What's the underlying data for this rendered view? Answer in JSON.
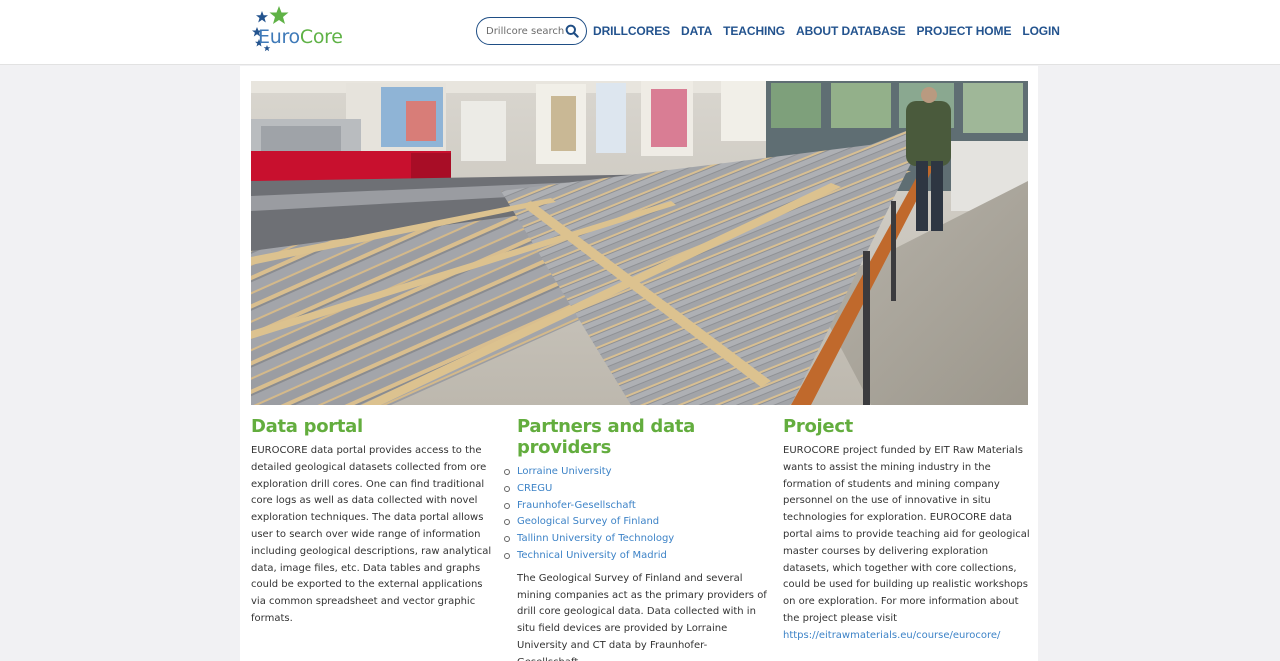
{
  "header": {
    "logo_euro": "Euro",
    "logo_core": "Core",
    "search_placeholder": "Drillcore search",
    "nav": [
      "DRILLCORES",
      "DATA",
      "TEACHING",
      "ABOUT DATABASE",
      "PROJECT HOME",
      "LOGIN"
    ]
  },
  "columns": {
    "data_portal": {
      "title": "Data portal",
      "text": "EUROCORE data portal provides access to the detailed geological datasets collected from ore exploration drill cores. One can find traditional core logs as well as data collected with novel exploration techniques. The data portal allows user to search over wide range of information including geological descriptions, raw analytical data, image files, etc. Data tables and graphs could be exported to the external applications via common spreadsheet and vector graphic formats."
    },
    "partners": {
      "title": "Partners and data providers",
      "items": [
        "Lorraine University",
        "CREGU",
        "Fraunhofer-Gesellschaft",
        "Geological Survey of Finland",
        "Tallinn University of Technology",
        "Technical University of Madrid"
      ],
      "text": "The Geological Survey of Finland and several mining companies act as the primary providers of drill core geological data. Data collected with in situ field devices are provided by Lorraine University and CT data by Fraunhofer-Gesellschaft."
    },
    "project": {
      "title": "Project",
      "text": "EUROCORE project funded by EIT Raw Materials wants to assist the mining industry in the formation of students and mining company personnel on the use of innovative in situ technologies for exploration. EUROCORE data portal aims to provide teaching aid for geological master courses by delivering exploration datasets, which together with core collections, could be used for building up realistic workshops on ore exploration. For more information about the project please visit",
      "link": "https://eitrawmaterials.eu/course/eurocore/"
    }
  },
  "colors": {
    "brand_blue": "#23538e",
    "brand_green": "#63ad3e",
    "link_blue": "#3d83c7"
  }
}
